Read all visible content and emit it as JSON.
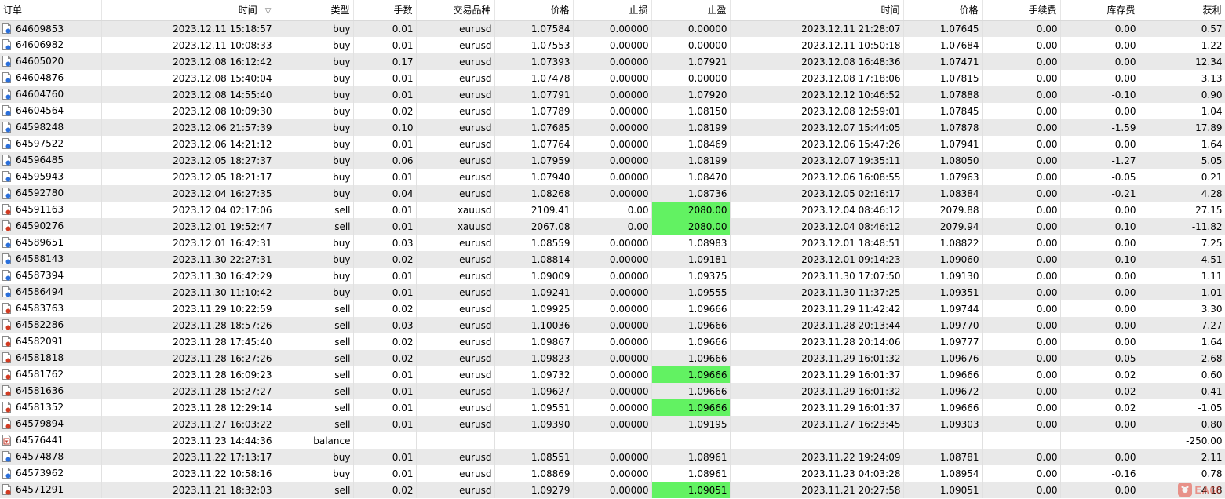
{
  "columns": [
    "订单",
    "时间",
    "类型",
    "手数",
    "交易品种",
    "价格",
    "止损",
    "止盈",
    "时间",
    "价格",
    "手续费",
    "库存费",
    "获利"
  ],
  "sort_column_index": 1,
  "highlight_color": "#62f262",
  "watermark": {
    "icon": "logo-icon",
    "text": "EA66"
  },
  "rows": [
    {
      "order": "64609853",
      "open_time": "2023.12.11 15:18:57",
      "type": "buy",
      "lots": "0.01",
      "symbol": "eurusd",
      "price": "1.07584",
      "sl": "0.00000",
      "tp": "0.00000",
      "close_time": "2023.12.11 21:28:07",
      "close_price": "1.07645",
      "commission": "0.00",
      "swap": "0.00",
      "profit": "0.57",
      "tp_hit": false
    },
    {
      "order": "64606982",
      "open_time": "2023.12.11 10:08:33",
      "type": "buy",
      "lots": "0.01",
      "symbol": "eurusd",
      "price": "1.07553",
      "sl": "0.00000",
      "tp": "0.00000",
      "close_time": "2023.12.11 10:50:18",
      "close_price": "1.07684",
      "commission": "0.00",
      "swap": "0.00",
      "profit": "1.22",
      "tp_hit": false
    },
    {
      "order": "64605020",
      "open_time": "2023.12.08 16:12:42",
      "type": "buy",
      "lots": "0.17",
      "symbol": "eurusd",
      "price": "1.07393",
      "sl": "0.00000",
      "tp": "1.07921",
      "close_time": "2023.12.08 16:48:36",
      "close_price": "1.07471",
      "commission": "0.00",
      "swap": "0.00",
      "profit": "12.34",
      "tp_hit": false
    },
    {
      "order": "64604876",
      "open_time": "2023.12.08 15:40:04",
      "type": "buy",
      "lots": "0.01",
      "symbol": "eurusd",
      "price": "1.07478",
      "sl": "0.00000",
      "tp": "0.00000",
      "close_time": "2023.12.08 17:18:06",
      "close_price": "1.07815",
      "commission": "0.00",
      "swap": "0.00",
      "profit": "3.13",
      "tp_hit": false
    },
    {
      "order": "64604760",
      "open_time": "2023.12.08 14:55:40",
      "type": "buy",
      "lots": "0.01",
      "symbol": "eurusd",
      "price": "1.07791",
      "sl": "0.00000",
      "tp": "1.07920",
      "close_time": "2023.12.12 10:46:52",
      "close_price": "1.07888",
      "commission": "0.00",
      "swap": "-0.10",
      "profit": "0.90",
      "tp_hit": false
    },
    {
      "order": "64604564",
      "open_time": "2023.12.08 10:09:30",
      "type": "buy",
      "lots": "0.02",
      "symbol": "eurusd",
      "price": "1.07789",
      "sl": "0.00000",
      "tp": "1.08150",
      "close_time": "2023.12.08 12:59:01",
      "close_price": "1.07845",
      "commission": "0.00",
      "swap": "0.00",
      "profit": "1.04",
      "tp_hit": false
    },
    {
      "order": "64598248",
      "open_time": "2023.12.06 21:57:39",
      "type": "buy",
      "lots": "0.10",
      "symbol": "eurusd",
      "price": "1.07685",
      "sl": "0.00000",
      "tp": "1.08199",
      "close_time": "2023.12.07 15:44:05",
      "close_price": "1.07878",
      "commission": "0.00",
      "swap": "-1.59",
      "profit": "17.89",
      "tp_hit": false
    },
    {
      "order": "64597522",
      "open_time": "2023.12.06 14:21:12",
      "type": "buy",
      "lots": "0.01",
      "symbol": "eurusd",
      "price": "1.07764",
      "sl": "0.00000",
      "tp": "1.08469",
      "close_time": "2023.12.06 15:47:26",
      "close_price": "1.07941",
      "commission": "0.00",
      "swap": "0.00",
      "profit": "1.64",
      "tp_hit": false
    },
    {
      "order": "64596485",
      "open_time": "2023.12.05 18:27:37",
      "type": "buy",
      "lots": "0.06",
      "symbol": "eurusd",
      "price": "1.07959",
      "sl": "0.00000",
      "tp": "1.08199",
      "close_time": "2023.12.07 19:35:11",
      "close_price": "1.08050",
      "commission": "0.00",
      "swap": "-1.27",
      "profit": "5.05",
      "tp_hit": false
    },
    {
      "order": "64595943",
      "open_time": "2023.12.05 18:21:17",
      "type": "buy",
      "lots": "0.01",
      "symbol": "eurusd",
      "price": "1.07940",
      "sl": "0.00000",
      "tp": "1.08470",
      "close_time": "2023.12.06 16:08:55",
      "close_price": "1.07963",
      "commission": "0.00",
      "swap": "-0.05",
      "profit": "0.21",
      "tp_hit": false
    },
    {
      "order": "64592780",
      "open_time": "2023.12.04 16:27:35",
      "type": "buy",
      "lots": "0.04",
      "symbol": "eurusd",
      "price": "1.08268",
      "sl": "0.00000",
      "tp": "1.08736",
      "close_time": "2023.12.05 02:16:17",
      "close_price": "1.08384",
      "commission": "0.00",
      "swap": "-0.21",
      "profit": "4.28",
      "tp_hit": false
    },
    {
      "order": "64591163",
      "open_time": "2023.12.04 02:17:06",
      "type": "sell",
      "lots": "0.01",
      "symbol": "xauusd",
      "price": "2109.41",
      "sl": "0.00",
      "tp": "2080.00",
      "close_time": "2023.12.04 08:46:12",
      "close_price": "2079.88",
      "commission": "0.00",
      "swap": "0.00",
      "profit": "27.15",
      "tp_hit": true
    },
    {
      "order": "64590276",
      "open_time": "2023.12.01 19:52:47",
      "type": "sell",
      "lots": "0.01",
      "symbol": "xauusd",
      "price": "2067.08",
      "sl": "0.00",
      "tp": "2080.00",
      "close_time": "2023.12.04 08:46:12",
      "close_price": "2079.94",
      "commission": "0.00",
      "swap": "0.10",
      "profit": "-11.82",
      "tp_hit": true
    },
    {
      "order": "64589651",
      "open_time": "2023.12.01 16:42:31",
      "type": "buy",
      "lots": "0.03",
      "symbol": "eurusd",
      "price": "1.08559",
      "sl": "0.00000",
      "tp": "1.08983",
      "close_time": "2023.12.01 18:48:51",
      "close_price": "1.08822",
      "commission": "0.00",
      "swap": "0.00",
      "profit": "7.25",
      "tp_hit": false
    },
    {
      "order": "64588143",
      "open_time": "2023.11.30 22:27:31",
      "type": "buy",
      "lots": "0.02",
      "symbol": "eurusd",
      "price": "1.08814",
      "sl": "0.00000",
      "tp": "1.09181",
      "close_time": "2023.12.01 09:14:23",
      "close_price": "1.09060",
      "commission": "0.00",
      "swap": "-0.10",
      "profit": "4.51",
      "tp_hit": false
    },
    {
      "order": "64587394",
      "open_time": "2023.11.30 16:42:29",
      "type": "buy",
      "lots": "0.01",
      "symbol": "eurusd",
      "price": "1.09009",
      "sl": "0.00000",
      "tp": "1.09375",
      "close_time": "2023.11.30 17:07:50",
      "close_price": "1.09130",
      "commission": "0.00",
      "swap": "0.00",
      "profit": "1.11",
      "tp_hit": false
    },
    {
      "order": "64586494",
      "open_time": "2023.11.30 11:10:42",
      "type": "buy",
      "lots": "0.01",
      "symbol": "eurusd",
      "price": "1.09241",
      "sl": "0.00000",
      "tp": "1.09555",
      "close_time": "2023.11.30 11:37:25",
      "close_price": "1.09351",
      "commission": "0.00",
      "swap": "0.00",
      "profit": "1.01",
      "tp_hit": false
    },
    {
      "order": "64583763",
      "open_time": "2023.11.29 10:22:59",
      "type": "sell",
      "lots": "0.02",
      "symbol": "eurusd",
      "price": "1.09925",
      "sl": "0.00000",
      "tp": "1.09666",
      "close_time": "2023.11.29 11:42:42",
      "close_price": "1.09744",
      "commission": "0.00",
      "swap": "0.00",
      "profit": "3.30",
      "tp_hit": false
    },
    {
      "order": "64582286",
      "open_time": "2023.11.28 18:57:26",
      "type": "sell",
      "lots": "0.03",
      "symbol": "eurusd",
      "price": "1.10036",
      "sl": "0.00000",
      "tp": "1.09666",
      "close_time": "2023.11.28 20:13:44",
      "close_price": "1.09770",
      "commission": "0.00",
      "swap": "0.00",
      "profit": "7.27",
      "tp_hit": false
    },
    {
      "order": "64582091",
      "open_time": "2023.11.28 17:45:40",
      "type": "sell",
      "lots": "0.02",
      "symbol": "eurusd",
      "price": "1.09867",
      "sl": "0.00000",
      "tp": "1.09666",
      "close_time": "2023.11.28 20:14:06",
      "close_price": "1.09777",
      "commission": "0.00",
      "swap": "0.00",
      "profit": "1.64",
      "tp_hit": false
    },
    {
      "order": "64581818",
      "open_time": "2023.11.28 16:27:26",
      "type": "sell",
      "lots": "0.02",
      "symbol": "eurusd",
      "price": "1.09823",
      "sl": "0.00000",
      "tp": "1.09666",
      "close_time": "2023.11.29 16:01:32",
      "close_price": "1.09676",
      "commission": "0.00",
      "swap": "0.05",
      "profit": "2.68",
      "tp_hit": false
    },
    {
      "order": "64581762",
      "open_time": "2023.11.28 16:09:23",
      "type": "sell",
      "lots": "0.01",
      "symbol": "eurusd",
      "price": "1.09732",
      "sl": "0.00000",
      "tp": "1.09666",
      "close_time": "2023.11.29 16:01:37",
      "close_price": "1.09666",
      "commission": "0.00",
      "swap": "0.02",
      "profit": "0.60",
      "tp_hit": true
    },
    {
      "order": "64581636",
      "open_time": "2023.11.28 15:27:27",
      "type": "sell",
      "lots": "0.01",
      "symbol": "eurusd",
      "price": "1.09627",
      "sl": "0.00000",
      "tp": "1.09666",
      "close_time": "2023.11.29 16:01:32",
      "close_price": "1.09672",
      "commission": "0.00",
      "swap": "0.02",
      "profit": "-0.41",
      "tp_hit": false
    },
    {
      "order": "64581352",
      "open_time": "2023.11.28 12:29:14",
      "type": "sell",
      "lots": "0.01",
      "symbol": "eurusd",
      "price": "1.09551",
      "sl": "0.00000",
      "tp": "1.09666",
      "close_time": "2023.11.29 16:01:37",
      "close_price": "1.09666",
      "commission": "0.00",
      "swap": "0.02",
      "profit": "-1.05",
      "tp_hit": true
    },
    {
      "order": "64579894",
      "open_time": "2023.11.27 16:03:22",
      "type": "sell",
      "lots": "0.01",
      "symbol": "eurusd",
      "price": "1.09390",
      "sl": "0.00000",
      "tp": "1.09195",
      "close_time": "2023.11.27 16:23:45",
      "close_price": "1.09303",
      "commission": "0.00",
      "swap": "0.00",
      "profit": "0.80",
      "tp_hit": false
    },
    {
      "order": "64576441",
      "open_time": "2023.11.23 14:44:36",
      "type": "balance",
      "lots": "",
      "symbol": "",
      "price": "",
      "sl": "",
      "tp": "",
      "close_time": "",
      "close_price": "",
      "commission": "",
      "swap": "",
      "profit": "-250.00",
      "tp_hit": false
    },
    {
      "order": "64574878",
      "open_time": "2023.11.22 17:13:17",
      "type": "buy",
      "lots": "0.01",
      "symbol": "eurusd",
      "price": "1.08551",
      "sl": "0.00000",
      "tp": "1.08961",
      "close_time": "2023.11.22 19:24:09",
      "close_price": "1.08781",
      "commission": "0.00",
      "swap": "0.00",
      "profit": "2.11",
      "tp_hit": false
    },
    {
      "order": "64573962",
      "open_time": "2023.11.22 10:58:16",
      "type": "buy",
      "lots": "0.01",
      "symbol": "eurusd",
      "price": "1.08869",
      "sl": "0.00000",
      "tp": "1.08961",
      "close_time": "2023.11.23 04:03:28",
      "close_price": "1.08954",
      "commission": "0.00",
      "swap": "-0.16",
      "profit": "0.78",
      "tp_hit": false
    },
    {
      "order": "64571291",
      "open_time": "2023.11.21 18:32:03",
      "type": "sell",
      "lots": "0.02",
      "symbol": "eurusd",
      "price": "1.09279",
      "sl": "0.00000",
      "tp": "1.09051",
      "close_time": "2023.11.21 20:27:58",
      "close_price": "1.09051",
      "commission": "0.00",
      "swap": "0.00",
      "profit": "4.18",
      "tp_hit": true
    }
  ]
}
